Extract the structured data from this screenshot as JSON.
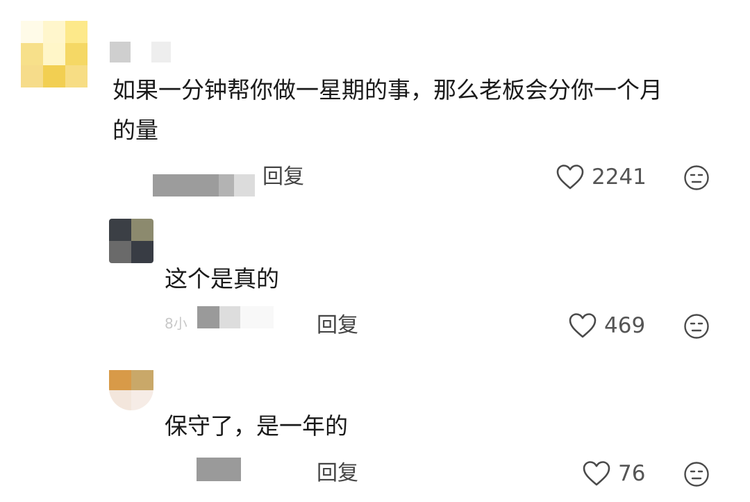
{
  "comments": [
    {
      "text_line1": "如果一分钟帮你做一星期的事，那么老板会分你一个月",
      "text_line2": "的量",
      "reply_label": "回复",
      "like_count": "2241",
      "like_icon": "heart-outline-icon",
      "dislike_icon": "neutral-face-icon"
    },
    {
      "text": "这个是真的",
      "time_fragment": "8小",
      "reply_label": "回复",
      "like_count": "469",
      "like_icon": "heart-outline-icon",
      "dislike_icon": "neutral-face-icon"
    },
    {
      "text": "保守了，是一年的",
      "reply_label": "回复",
      "like_count": "76",
      "like_icon": "heart-outline-icon",
      "dislike_icon": "neutral-face-icon"
    }
  ],
  "colors": {
    "text": "#1a1a1a",
    "secondary": "#555555",
    "background": "#ffffff"
  }
}
